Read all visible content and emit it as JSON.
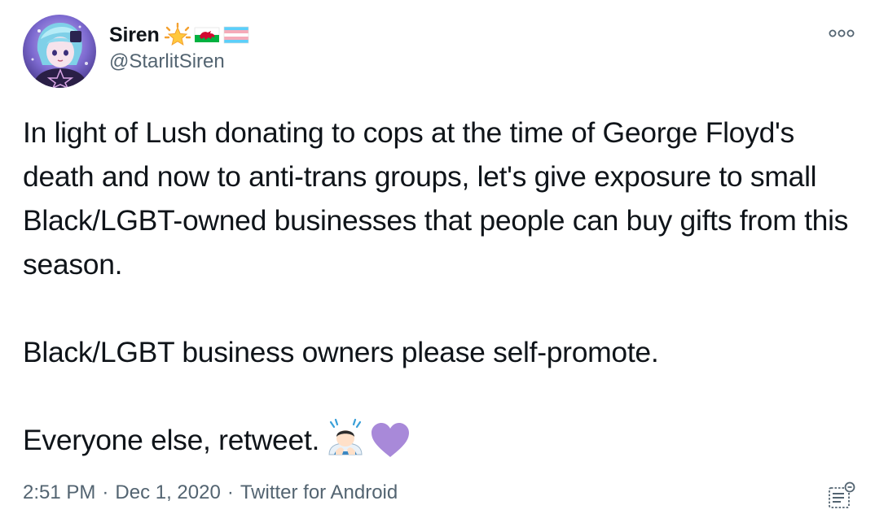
{
  "author": {
    "display_name": "Siren",
    "handle": "@StarlitSiren",
    "name_emojis": [
      "star-emoji",
      "wales-flag-emoji",
      "trans-flag-emoji"
    ]
  },
  "tweet": {
    "paragraphs": [
      "In light of Lush donating to cops at the time of George Floyd's death and now to anti-trans groups, let's give exposure to small Black/LGBT-owned businesses that people can buy gifts from this season.",
      "Black/LGBT business owners please self-promote.",
      "Everyone else, retweet."
    ],
    "trailing_emojis": [
      "bowing-person-emoji",
      "purple-heart-emoji"
    ]
  },
  "meta": {
    "time": "2:51 PM",
    "date": "Dec 1, 2020",
    "source": "Twitter for Android",
    "separator": "·"
  },
  "colors": {
    "text": "#0f1419",
    "secondary": "#536471",
    "purple_heart": "#a889d9"
  },
  "icons": {
    "more": "more-options-icon",
    "analytics": "tweet-analytics-icon"
  }
}
